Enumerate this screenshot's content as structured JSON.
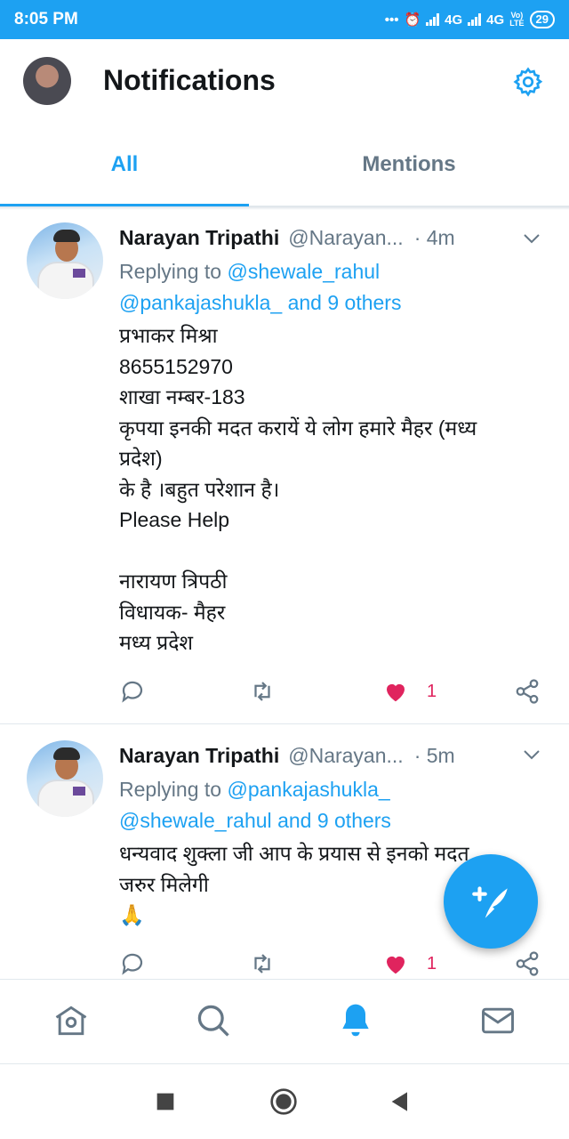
{
  "status_bar": {
    "time": "8:05 PM",
    "network": "4G",
    "network2": "4G",
    "volte": "VoLTE",
    "battery": "29"
  },
  "header": {
    "title": "Notifications"
  },
  "tabs": [
    {
      "label": "All",
      "active": true
    },
    {
      "label": "Mentions",
      "active": false
    }
  ],
  "tweets": [
    {
      "name": "Narayan Tripathi",
      "handle": "@Narayan...",
      "sep": "·",
      "time": "4m",
      "replying_prefix": "Replying to",
      "replying_user1": "@shewale_rahul",
      "replying_user2": "@pankajashukla_",
      "replying_others": "and 9 others",
      "lines": [
        "प्रभाकर मिश्रा",
        "8655152970",
        "शाखा नम्बर-183",
        "कृपया इनकी  मदत करायें ये लोग हमारे मैहर (मध्य",
        "प्रदेश)",
        "के है  ।बहुत परेशान है।",
        "Please Help",
        "",
        "नारायण त्रिपठी",
        "विधायक- मैहर",
        "मध्य प्रदेश"
      ],
      "like_count": "1"
    },
    {
      "name": "Narayan Tripathi",
      "handle": "@Narayan...",
      "sep": "·",
      "time": "5m",
      "replying_prefix": "Replying to",
      "replying_user1": "@pankajashukla_",
      "replying_user2": "@shewale_rahul",
      "replying_others": "and 9 others",
      "lines": [
        "धन्यवाद शुक्ला जी आप के प्रयास से इनको मदत",
        "जरुर मिलेगी",
        "🙏"
      ],
      "like_count": "1"
    }
  ],
  "colors": {
    "accent": "#1da1f2",
    "like": "#e0245e",
    "muted": "#657786",
    "text": "#14171a"
  },
  "icons": {
    "settings": "gear-icon",
    "reply": "reply-icon",
    "retweet": "retweet-icon",
    "like": "heart-icon",
    "share": "share-icon",
    "compose": "compose-tweet-icon",
    "home": "home-icon",
    "search": "search-icon",
    "notifications": "bell-icon",
    "messages": "mail-icon"
  }
}
